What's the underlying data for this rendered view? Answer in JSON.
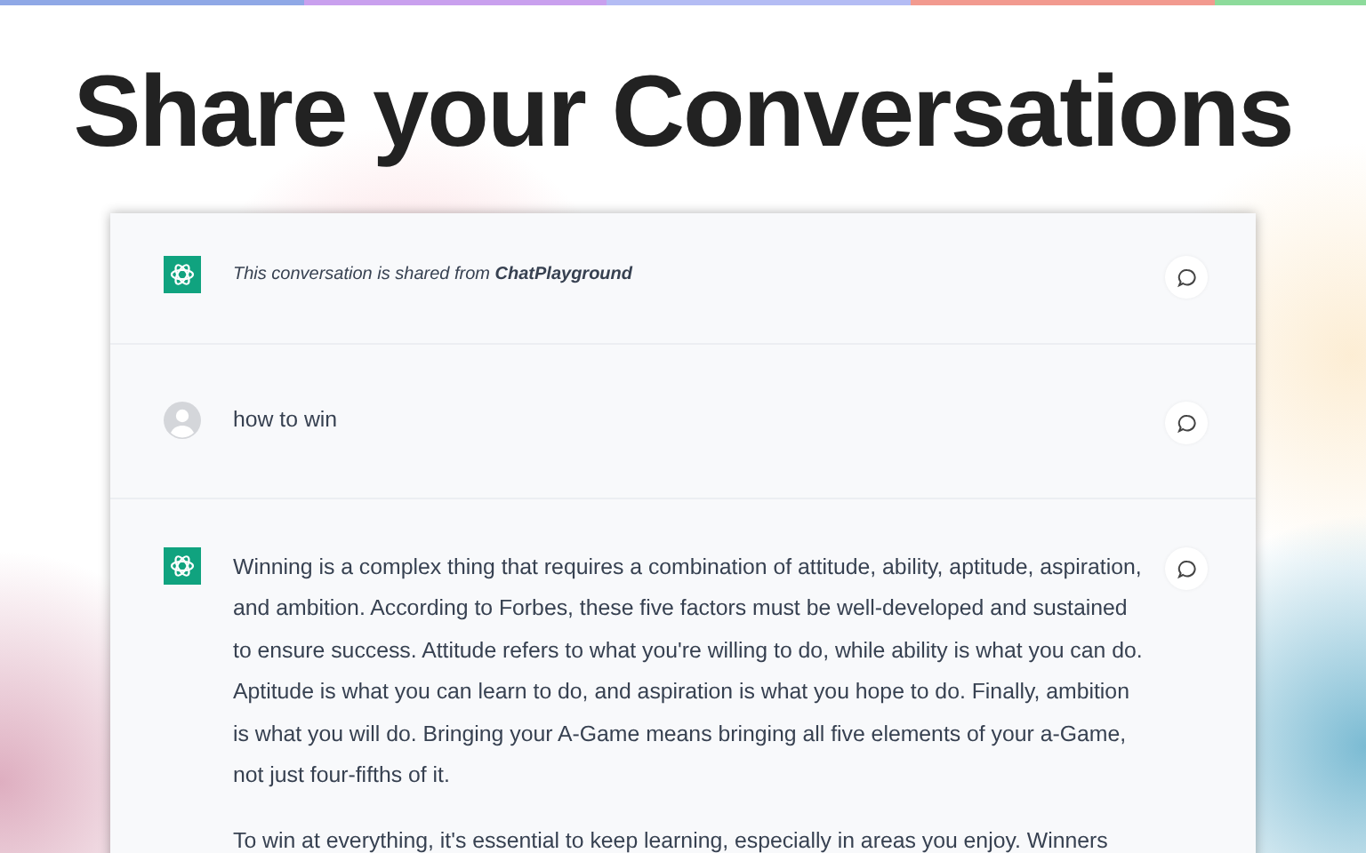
{
  "heading": "Share your Conversations",
  "messages": [
    {
      "kind": "info",
      "text": "This conversation is shared from **ChatPlayground**"
    },
    {
      "kind": "user",
      "text": "how to win"
    },
    {
      "kind": "assistant",
      "paragraphs": [
        "Winning is a complex thing that requires a combination of attitude, ability, aptitude, aspiration, and ambition. According to Forbes, these five factors must be well-developed and sustained to ensure success. Attitude refers to what you're willing to do, while ability is what you can do. Aptitude is what you can learn to do, and aspiration is what you hope to do. Finally, ambition is what you will do. Bringing your A-Game means bringing all five elements of your a-Game, not just four-fifths of it.",
        "To win at everything, it's essential to keep learning, especially in areas you enjoy. Winners"
      ]
    }
  ]
}
